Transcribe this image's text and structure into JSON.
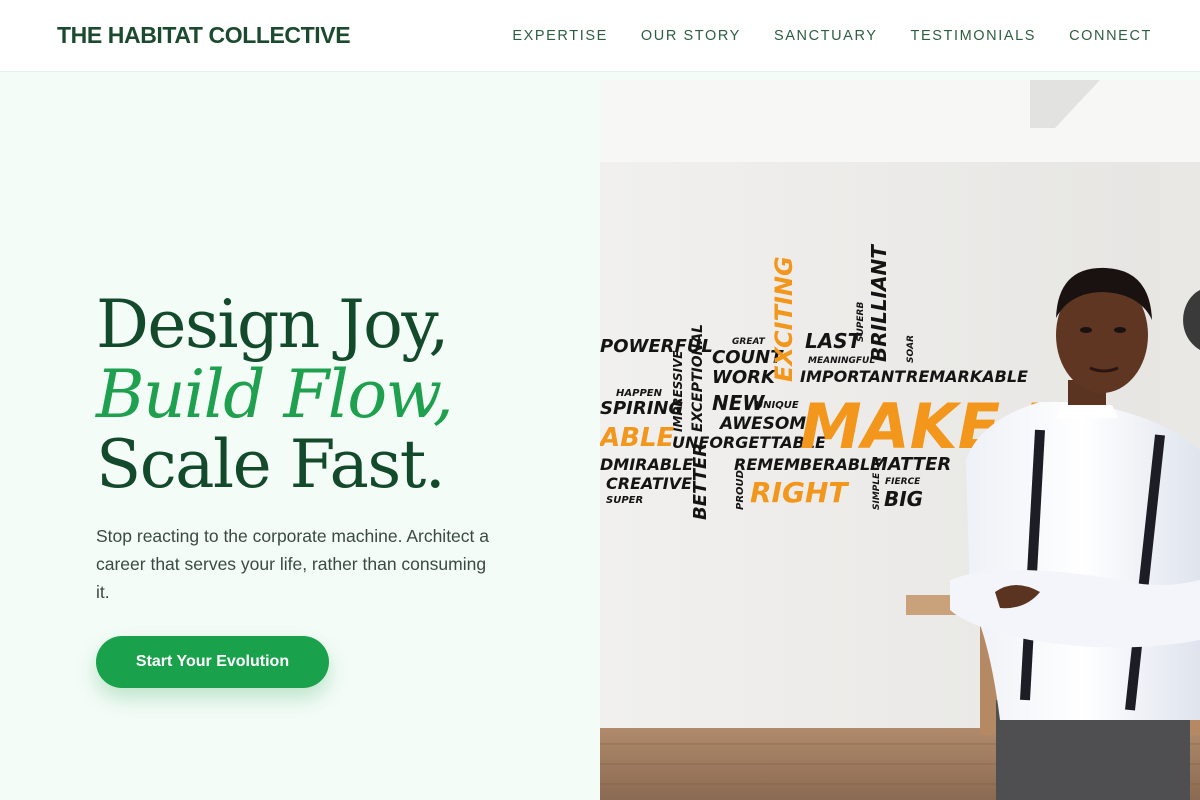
{
  "header": {
    "brand": "THE HABITAT COLLECTIVE",
    "nav": [
      "EXPERTISE",
      "OUR STORY",
      "SANCTUARY",
      "TESTIMONIALS",
      "CONNECT"
    ]
  },
  "hero": {
    "headline_line1": "Design Joy,",
    "headline_line2": "Build Flow,",
    "headline_line3": "Scale Fast.",
    "subtext": "Stop reacting to the corporate machine. Architect a career that serves your life, rather than consuming it.",
    "cta_label": "Start Your Evolution"
  },
  "image": {
    "wall_words": {
      "make_it": "MAKE IT",
      "right": "RIGHT",
      "exciting": "EXCITING",
      "powerful": "POWERFUL",
      "count": "COUNT",
      "work": "WORK",
      "great": "GREAT",
      "last": "LAST",
      "meaningful": "MEANINGFUL",
      "important": "IMPORTANT",
      "superb": "SUPERB",
      "brilliant": "BRILLIANT",
      "soar": "SOAR",
      "remarkable": "REMARKABLE",
      "happen": "HAPPEN",
      "spiring": "SPIRING",
      "impressive": "IMPRESSIVE",
      "exceptional": "EXCEPTIONAL",
      "new": "NEW",
      "unique": "UNIQUE",
      "awesome": "AWESOME",
      "able": "ABLE",
      "unforgettable": "UNFORGETTABLE",
      "dmirable": "DMIRABLE",
      "better": "BETTER",
      "rememberable": "REMEMBERABLE",
      "matter": "MATTER",
      "creative": "CREATIVE",
      "super": "SUPER",
      "proud": "PROUD",
      "simple": "SIMPLE",
      "fierce": "FIERCE",
      "big": "BIG"
    }
  },
  "colors": {
    "brand": "#1c4a2e",
    "accent": "#1ea04e",
    "cta": "#1aa14c",
    "background": "#f4fcf7"
  }
}
